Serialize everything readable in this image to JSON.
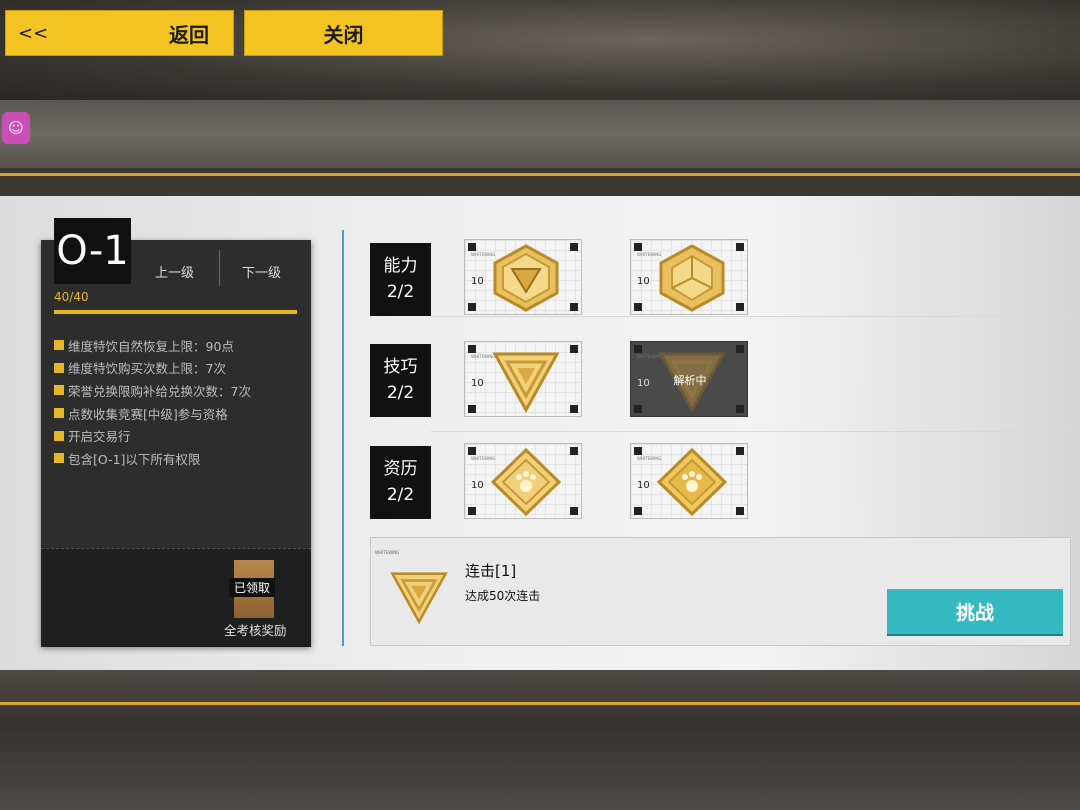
{
  "header": {
    "back_arrow": "<<",
    "back_label": "返回",
    "close_label": "关闭"
  },
  "level": {
    "code": "O-1",
    "prev_label": "上一级",
    "next_label": "下一级",
    "progress_text": "40/40",
    "progress_fraction": 1.0,
    "perks": [
      "维度特饮自然恢复上限：90点",
      "维度特饮购买次数上限：7次",
      "荣誉兑换限购补给兑换次数：7次",
      "点数收集竞赛[中级]参与资格",
      "开启交易行",
      "包含[O-1]以下所有权限"
    ],
    "reward": {
      "status": "已领取",
      "label": "全考核奖励"
    }
  },
  "categories": [
    {
      "name": "能力",
      "count": "2/2",
      "medals": [
        {
          "tag": "WHITEWING",
          "value": "10",
          "shape": "hex-triangle"
        },
        {
          "tag": "WHITEWING",
          "value": "10",
          "shape": "hex-cube"
        }
      ]
    },
    {
      "name": "技巧",
      "count": "2/2",
      "medals": [
        {
          "tag": "WHITEWING",
          "value": "10",
          "shape": "triangle"
        },
        {
          "tag": "WHITEWING",
          "value": "10",
          "shape": "triangle",
          "status": "解析中"
        }
      ]
    },
    {
      "name": "资历",
      "count": "2/2",
      "medals": [
        {
          "tag": "WHITEWING",
          "value": "10",
          "shape": "diamond-paw"
        },
        {
          "tag": "WHITEWING",
          "value": "10",
          "shape": "diamond-paw"
        }
      ]
    }
  ],
  "challenge": {
    "tag": "WHITEWING",
    "title": "连击[1]",
    "description": "达成50次连击",
    "button_label": "挑战"
  },
  "colors": {
    "accent_yellow": "#f3c321",
    "gold": "#e6b72a",
    "teal": "#36b8c0"
  }
}
